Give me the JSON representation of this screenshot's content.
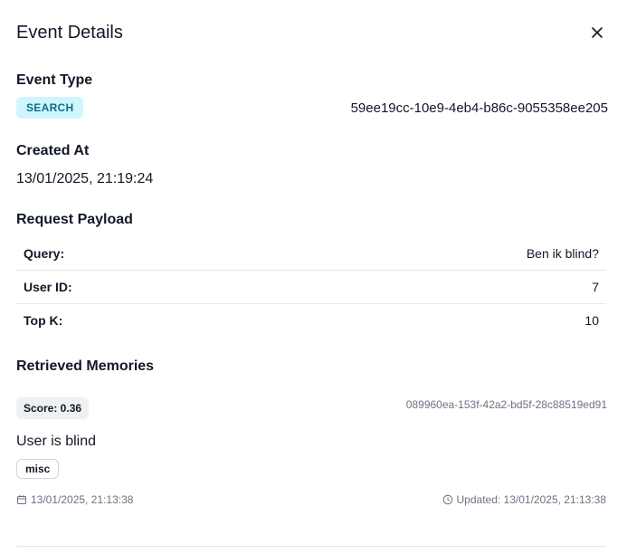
{
  "dialog": {
    "title": "Event Details",
    "close_icon": "close-icon"
  },
  "event_type": {
    "heading": "Event Type",
    "badge": "SEARCH",
    "id": "59ee19cc-10e9-4eb4-b86c-9055358ee205",
    "badge_bg": "#cff6fc",
    "badge_color": "#0e6f86"
  },
  "created_at": {
    "heading": "Created At",
    "value": "13/01/2025, 21:19:24"
  },
  "request_payload": {
    "heading": "Request Payload",
    "rows": [
      {
        "key": "Query:",
        "value": "Ben ik blind?"
      },
      {
        "key": "User ID:",
        "value": "7"
      },
      {
        "key": "Top K:",
        "value": "10"
      }
    ]
  },
  "retrieved_memories": {
    "heading": "Retrieved Memories",
    "items": [
      {
        "score": "Score: 0.36",
        "id": "089960ea-153f-42a2-bd5f-28c88519ed91",
        "text": "User is blind",
        "tag": "misc",
        "created": "13/01/2025, 21:13:38",
        "created_icon": "calendar-icon",
        "updated": "Updated: 13/01/2025, 21:13:38",
        "updated_icon": "clock-icon"
      }
    ]
  }
}
